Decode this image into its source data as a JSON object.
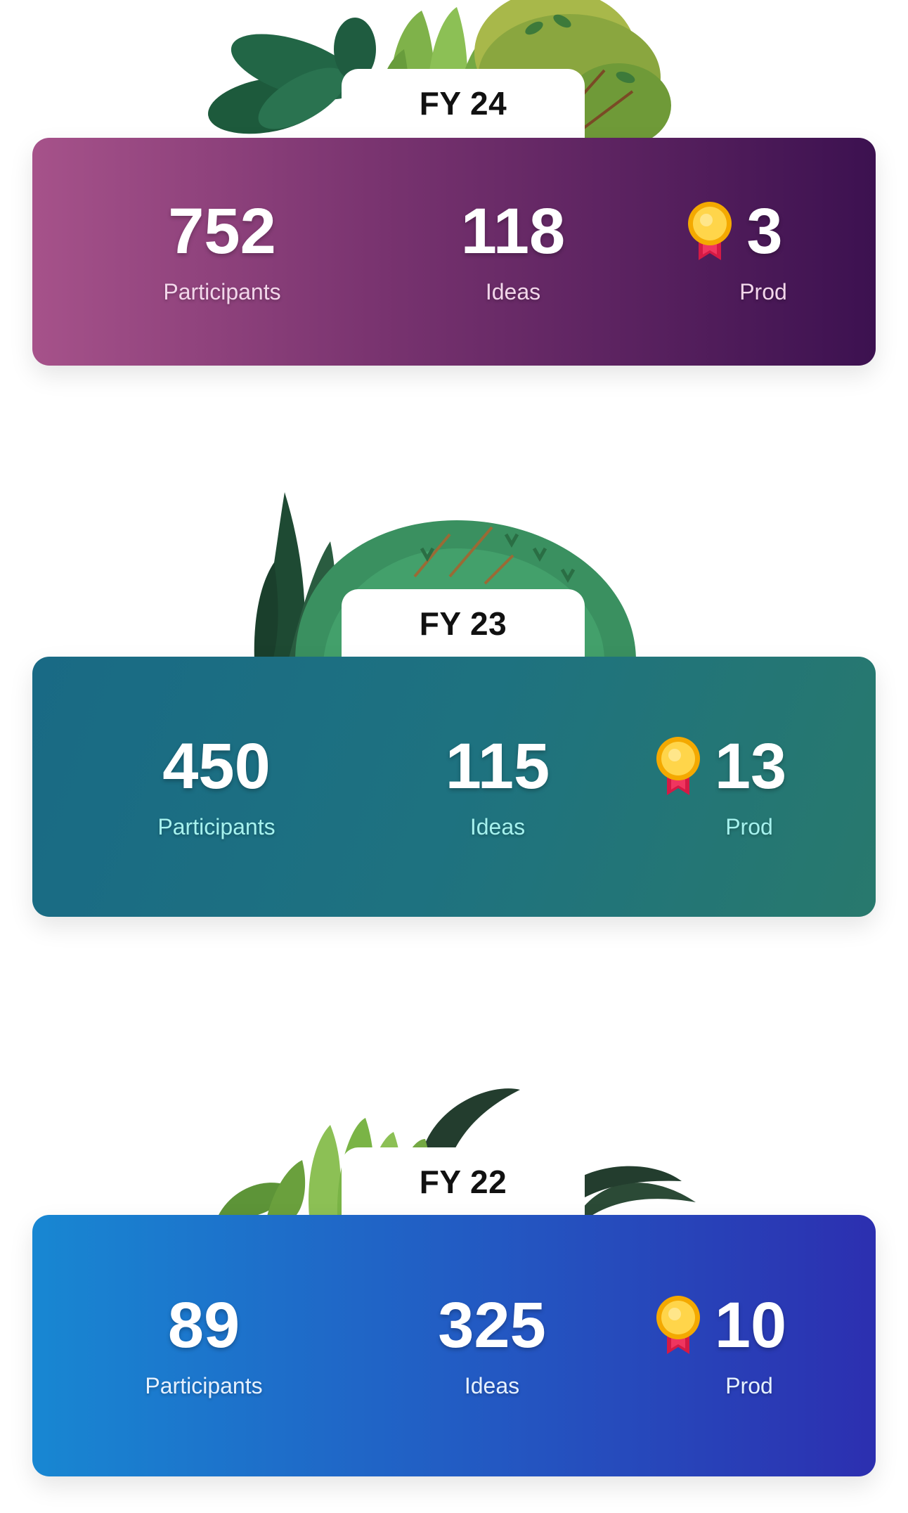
{
  "cards": [
    {
      "year": "FY 24",
      "participants": "752",
      "participants_label": "Participants",
      "ideas": "118",
      "ideas_label": "Ideas",
      "prod": "3",
      "prod_label": "Prod",
      "gradient": [
        "#a6528a",
        "#3c1150"
      ],
      "label_color": "#f2d6ea",
      "medal_icon": "award-medal-icon"
    },
    {
      "year": "FY 23",
      "participants": "450",
      "participants_label": "Participants",
      "ideas": "115",
      "ideas_label": "Ideas",
      "prod": "13",
      "prod_label": "Prod",
      "gradient": [
        "#196a85",
        "#28796d"
      ],
      "label_color": "#a6f2ee",
      "medal_icon": "award-medal-icon"
    },
    {
      "year": "FY 22",
      "participants": "89",
      "participants_label": "Participants",
      "ideas": "325",
      "ideas_label": "Ideas",
      "prod": "10",
      "prod_label": "Prod",
      "gradient": [
        "#1887d2",
        "#2c2fb0"
      ],
      "label_color": "#e6f1ff",
      "medal_icon": "award-medal-icon"
    }
  ]
}
